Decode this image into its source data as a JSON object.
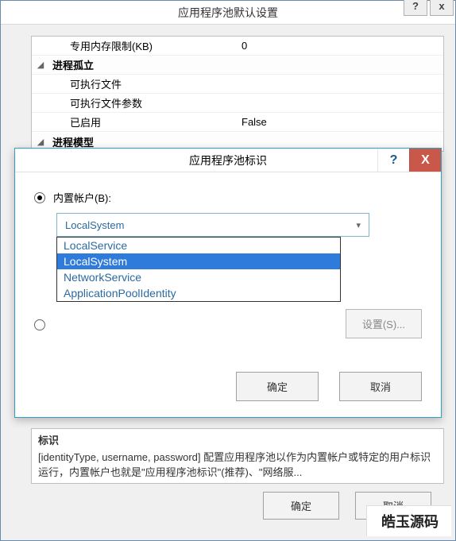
{
  "backDialog": {
    "title": "应用程序池默认设置",
    "helpBtn": "?",
    "closeBtn": "x",
    "rows": {
      "r0_name": "专用内存限制(KB)",
      "r0_val": "0",
      "cat1": "进程孤立",
      "r1a": "可执行文件",
      "r1b": "可执行文件参数",
      "r1c": "已启用",
      "r1c_val": "False",
      "cat2": "进程模型"
    },
    "desc_title": "标识",
    "desc_body": "[identityType, username, password] 配置应用程序池以作为内置帐户或特定的用户标识运行，内置帐户也就是\"应用程序池标识\"(推荐)、\"网络服...",
    "ok": "确定",
    "cancel": "取消"
  },
  "frontDialog": {
    "title": "应用程序池标识",
    "help": "?",
    "close": "X",
    "builtin_label": "内置帐户(B):",
    "combo_value": "LocalSystem",
    "options": {
      "o0": "LocalService",
      "o1": "LocalSystem",
      "o2": "NetworkService",
      "o3": "ApplicationPoolIdentity"
    },
    "custom_label": "",
    "settings": "设置(S)...",
    "ok": "确定",
    "cancel": "取消"
  },
  "watermark": "皓玉源码"
}
